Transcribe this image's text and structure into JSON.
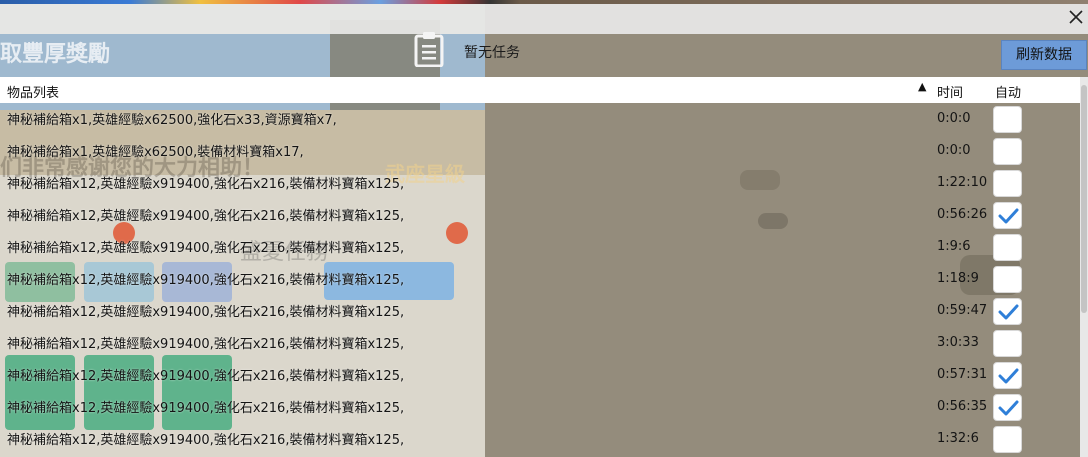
{
  "header": {
    "no_task_text": "暂无任务",
    "refresh_label": "刷新数据"
  },
  "background_text": {
    "reward": "取豐厚獎勵",
    "slogan": "们非常感谢您的大力相助！",
    "level": "武座星級",
    "upgrade": "盛夏任務"
  },
  "table": {
    "columns": {
      "items": "物品列表",
      "time": "时间",
      "auto": "自动"
    },
    "rows": [
      {
        "items": "神秘補給箱x1,英雄經驗x62500,強化石x33,資源寶箱x7,",
        "time": "0:0:0",
        "auto": false
      },
      {
        "items": "神秘補給箱x1,英雄經驗x62500,裝備材料寶箱x17,",
        "time": "0:0:0",
        "auto": false
      },
      {
        "items": "神秘補給箱x12,英雄經驗x919400,強化石x216,裝備材料寶箱x125,",
        "time": "1:22:10",
        "auto": false
      },
      {
        "items": "神秘補給箱x12,英雄經驗x919400,強化石x216,裝備材料寶箱x125,",
        "time": "0:56:26",
        "auto": true
      },
      {
        "items": "神秘補給箱x12,英雄經驗x919400,強化石x216,裝備材料寶箱x125,",
        "time": "1:9:6",
        "auto": false
      },
      {
        "items": "神秘補給箱x12,英雄經驗x919400,強化石x216,裝備材料寶箱x125,",
        "time": "1:18:9",
        "auto": false
      },
      {
        "items": "神秘補給箱x12,英雄經驗x919400,強化石x216,裝備材料寶箱x125,",
        "time": "0:59:47",
        "auto": true
      },
      {
        "items": "神秘補給箱x12,英雄經驗x919400,強化石x216,裝備材料寶箱x125,",
        "time": "3:0:33",
        "auto": false
      },
      {
        "items": "神秘補給箱x12,英雄經驗x919400,強化石x216,裝備材料寶箱x125,",
        "time": "0:57:31",
        "auto": true
      },
      {
        "items": "神秘補給箱x12,英雄經驗x919400,強化石x216,裝備材料寶箱x125,",
        "time": "0:56:35",
        "auto": true
      },
      {
        "items": "神秘補給箱x12,英雄經驗x919400,強化石x216,裝備材料寶箱x125,",
        "time": "1:32:6",
        "auto": false
      }
    ]
  },
  "icons": {
    "close": "close-icon",
    "task": "clipboard-icon",
    "sort": "sort-up-icon",
    "check": "check-icon"
  },
  "colors": {
    "refresh_button": "#6d9bd8",
    "check_mark": "#2f7fd8",
    "header_bg": "#ffffff"
  }
}
